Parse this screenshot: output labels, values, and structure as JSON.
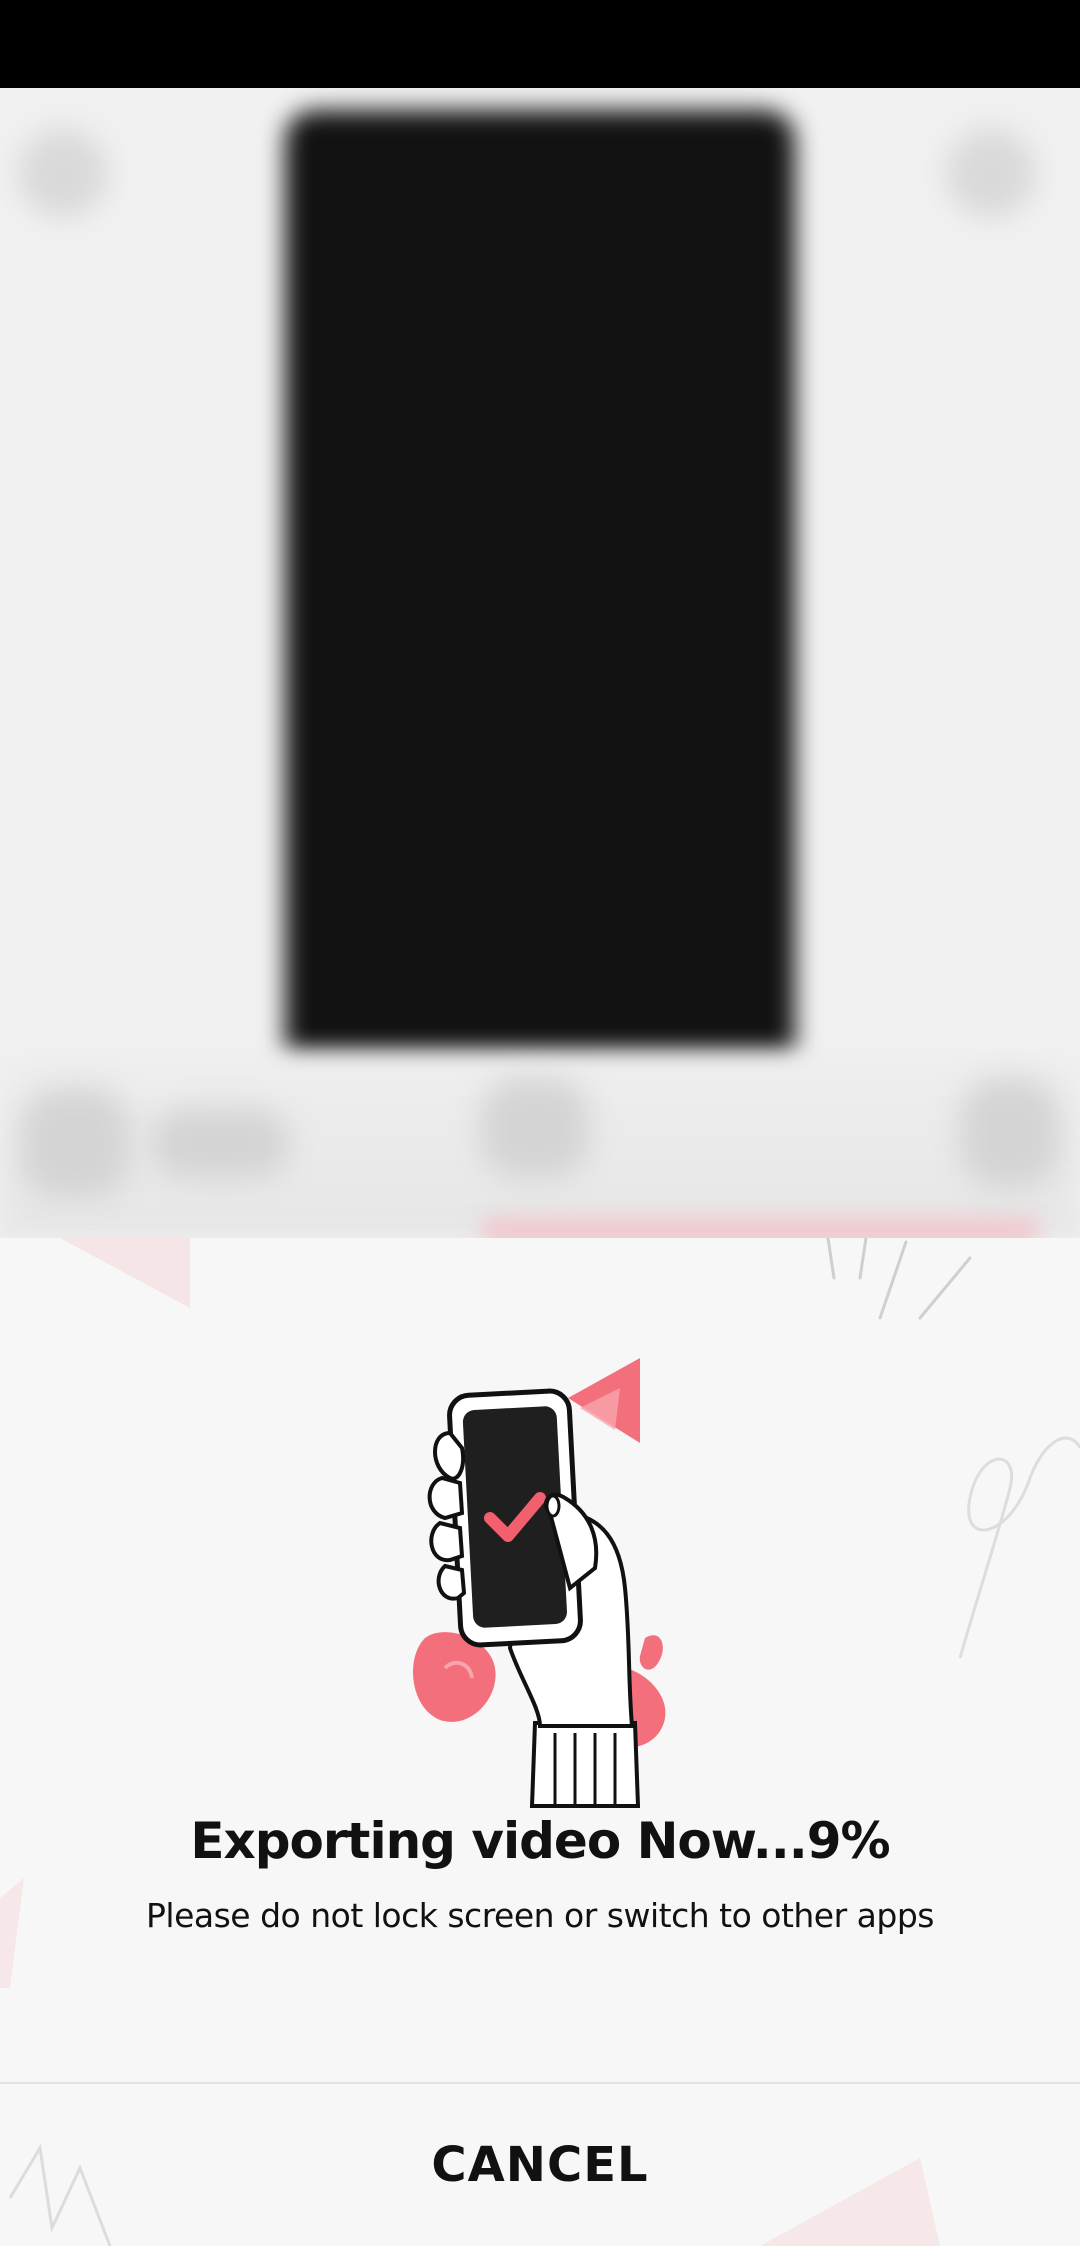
{
  "export_dialog": {
    "title": "Exporting video Now...9%",
    "progress_percent": 9,
    "subtitle": "Please do not lock screen or switch to other apps",
    "cancel_label": "CANCEL"
  },
  "colors": {
    "accent": "#f25f6e",
    "background": "#f7f7f7",
    "text": "#111111",
    "video_frame": "#121212"
  },
  "icons": {
    "illustration": "phone-in-hand-checkmark-illustration"
  }
}
